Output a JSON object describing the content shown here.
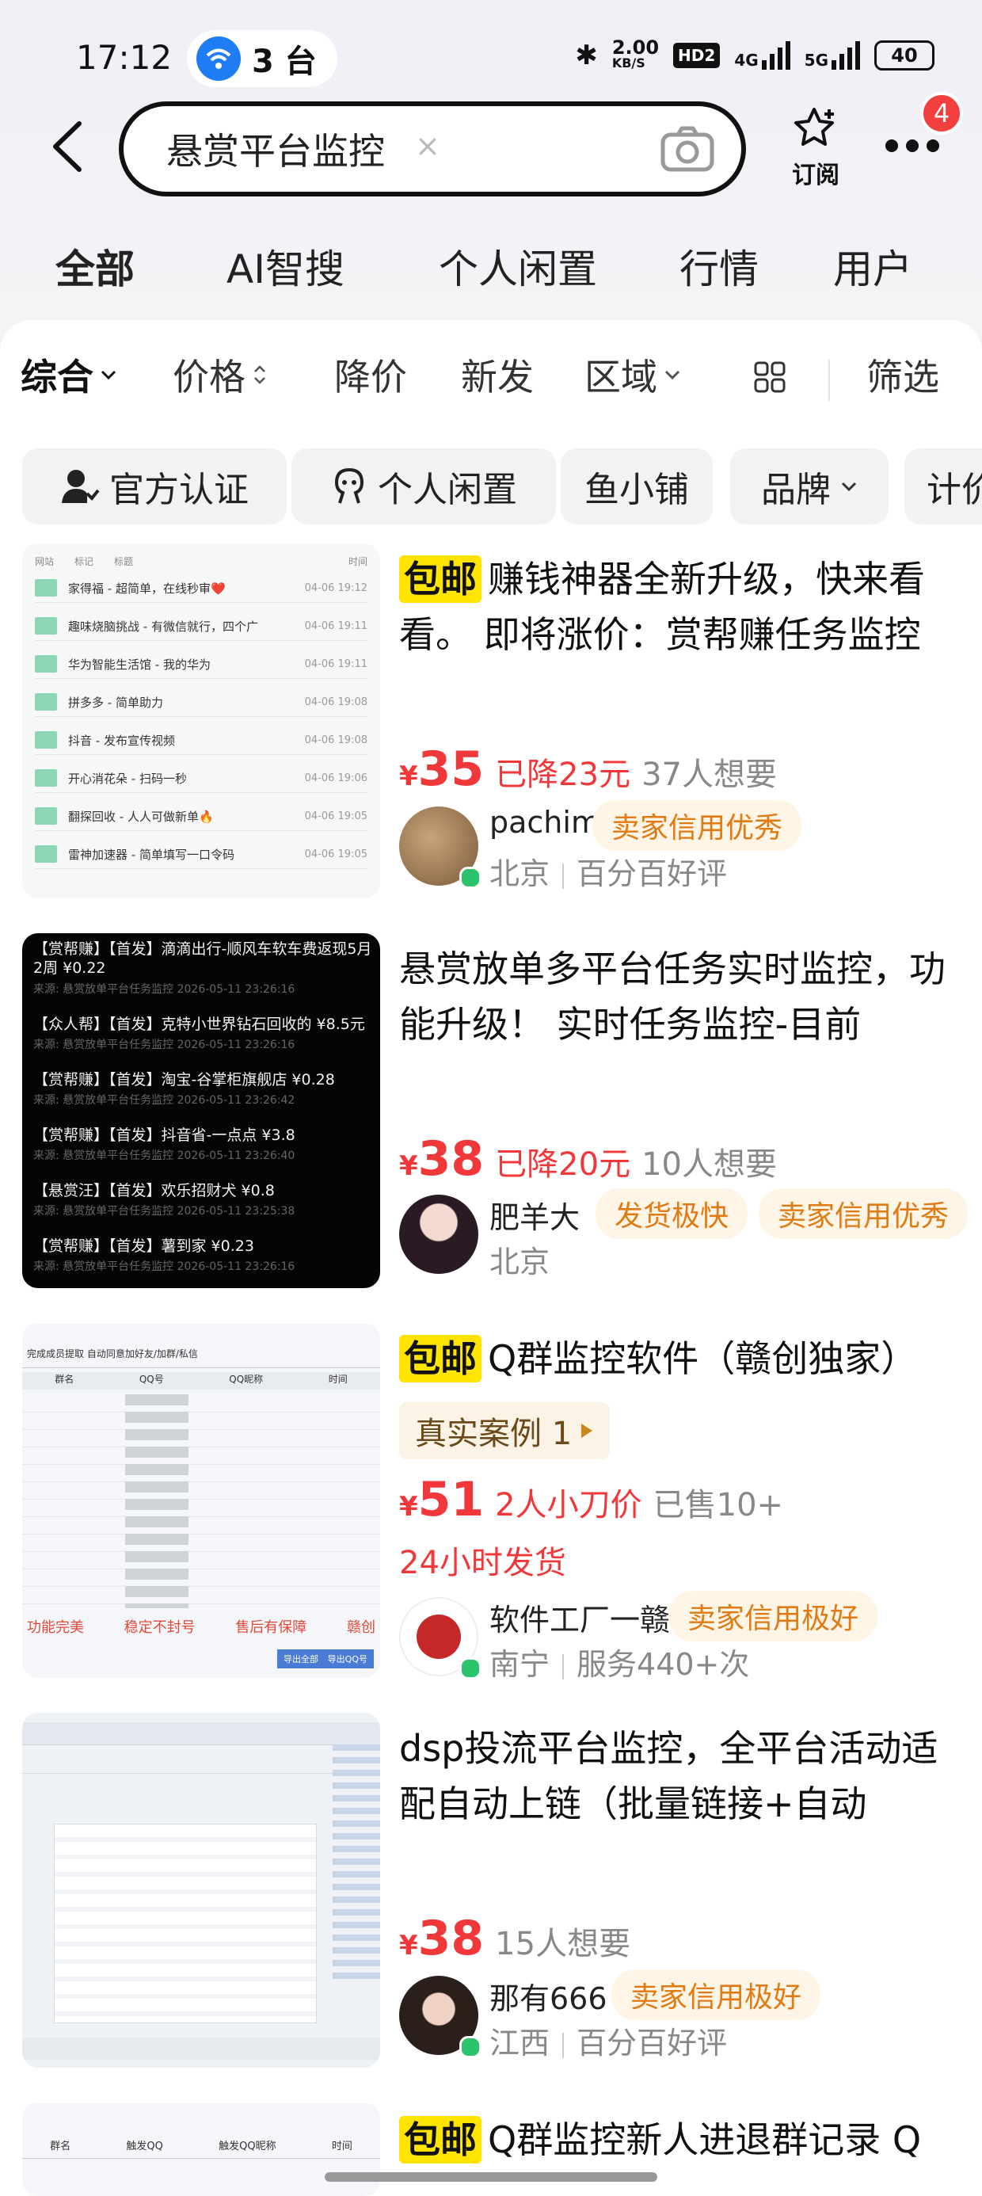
{
  "status": {
    "time": "17:12",
    "notif_count_label": "3 台",
    "speed": "2.00",
    "speed_unit": "KB/S",
    "hd": "HD2",
    "net1": "4G",
    "net2": "5G",
    "battery": "40"
  },
  "search": {
    "query": "悬赏平台监控",
    "clear": "×",
    "subscribe_label": "订阅",
    "more_badge": "4"
  },
  "tabs": [
    "全部",
    "AI智搜",
    "个人闲置",
    "行情",
    "用户"
  ],
  "sortbar": {
    "comprehensive": "综合",
    "price": "价格",
    "price_drop": "降价",
    "new": "新发",
    "region": "区域",
    "filter": "筛选"
  },
  "chips": [
    "官方认证",
    "个人闲置",
    "鱼小铺",
    "品牌",
    "计价"
  ],
  "listings": [
    {
      "free_shipping": "包邮",
      "title": "赚钱神器全新升级，快来看看。 即将涨价：赏帮赚任务监控",
      "yen": "¥",
      "price": "35",
      "drop": "已降23元",
      "want": "37人想要",
      "seller": "pachim",
      "tags": [
        "卖家信用优秀"
      ],
      "location": "北京",
      "rating": "百分百好评",
      "thumb_rows": [
        "家得福 - 超简单，在线秒审❤️",
        "趣味烧脑挑战 - 有微信就行，四个广",
        "华为智能生活馆 - 我的华为",
        "拼多多 - 简单助力",
        "抖音 - 发布宣传视频",
        "开心消花朵 - 扫码一秒",
        "翻探回收 - 人人可做新单🔥",
        "雷神加速器 - 简单填写一口令码"
      ],
      "thumb_times": [
        "04-06 19:12",
        "04-06 19:11",
        "04-06 19:11",
        "04-06 19:08",
        "04-06 19:08",
        "04-06 19:06",
        "04-06 19:05",
        "04-06 19:05"
      ],
      "thumb_head": [
        "网站",
        "标记",
        "标题",
        "时间"
      ]
    },
    {
      "free_shipping": "",
      "title": "悬赏放单多平台任务实时监控，功能升级！ 实时任务监控-目前",
      "yen": "¥",
      "price": "38",
      "drop": "已降20元",
      "want": "10人想要",
      "seller": "肥羊大",
      "tags": [
        "发货极快",
        "卖家信用优秀"
      ],
      "location": "北京",
      "rating": "",
      "thumb_lines": [
        "【赏帮赚】【首发】滴滴出行-顺风车软车费返现5月2周 ¥0.22",
        "【众人帮】【首发】克特小世界钻石回收的 ¥8.5元",
        "【赏帮赚】【首发】淘宝-谷掌柜旗舰店 ¥0.28",
        "【赏帮赚】【首发】抖音省-一点点 ¥3.8",
        "【悬赏汪】【首发】欢乐招财犬 ¥0.8",
        "【赏帮赚】【首发】薯到家 ¥0.23"
      ],
      "thumb_subs": [
        "来源: 悬赏放单平台任务监控   2026-05-11 23:26:16",
        "来源: 悬赏放单平台任务监控   2026-05-11 23:26:16",
        "来源: 悬赏放单平台任务监控   2026-05-11 23:26:42",
        "来源: 悬赏放单平台任务监控   2026-05-11 23:26:40",
        "来源: 悬赏放单平台任务监控   2026-05-11 23:25:38",
        "来源: 悬赏放单平台任务监控   2026-05-11 23:26:16"
      ]
    },
    {
      "free_shipping": "包邮",
      "title": "Q群监控软件（赣创独家）",
      "case_label": "真实案例 1",
      "yen": "¥",
      "price": "51",
      "drop": "2人小刀价",
      "want": "已售10+",
      "delivery": "24小时发货",
      "seller": "软件工厂一赣",
      "tags": [
        "卖家信用极好"
      ],
      "location": "南宁",
      "rating": "服务440+次",
      "thumb_tabs": "完成成员提取  自动同意加好友/加群/私信",
      "thumb_head": [
        "群名",
        "QQ号",
        "QQ昵称",
        "时间"
      ],
      "thumb_footer": [
        "功能完美",
        "稳定不封号",
        "售后有保障",
        "赣创"
      ],
      "thumb_buttons": [
        "导出全部",
        "导出QQ号"
      ]
    },
    {
      "free_shipping": "",
      "title": "dsp投流平台监控，全平台活动适配自动上链（批量链接+自动",
      "yen": "¥",
      "price": "38",
      "drop": "",
      "want": "15人想要",
      "seller": "那有666",
      "tags": [
        "卖家信用极好"
      ],
      "location": "江西",
      "rating": "百分百好评"
    },
    {
      "free_shipping": "包邮",
      "title": "Q群监控新人进退群记录 Q",
      "thumb_head": [
        "群名",
        "触发QQ",
        "触发QQ昵称",
        "时间"
      ]
    }
  ]
}
